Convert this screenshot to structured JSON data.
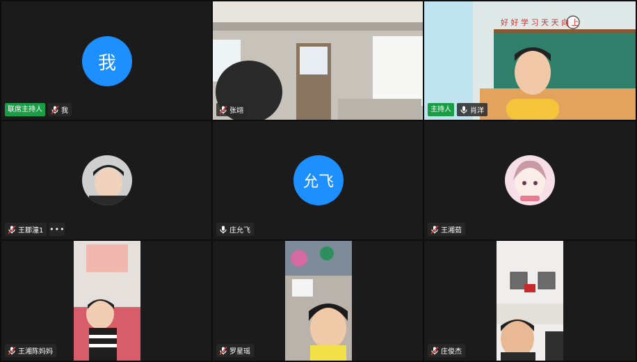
{
  "tiles": [
    {
      "role": "联席主持人",
      "name": "我",
      "avatar_text": "我",
      "mic": "muted"
    },
    {
      "name": "张翊",
      "mic": "muted"
    },
    {
      "role": "主持人",
      "name": "肖洋",
      "mic": "on"
    },
    {
      "name": "王鄒潼1",
      "mic": "muted"
    },
    {
      "name": "庄允飞",
      "avatar_text": "允飞",
      "mic": "on"
    },
    {
      "name": "王湘茹",
      "mic": "muted"
    },
    {
      "name": "王湘陈妈妈",
      "mic": "muted"
    },
    {
      "name": "罗星瑶",
      "mic": "muted"
    },
    {
      "name": "庄俊杰",
      "mic": "muted"
    }
  ],
  "classroom_banner": "好 好 学 习   天 天 向 上",
  "avatar_color": "#1e8fff",
  "host_badge_color": "#1a9e45",
  "more_button_text": "•••",
  "next_arrow": "›"
}
